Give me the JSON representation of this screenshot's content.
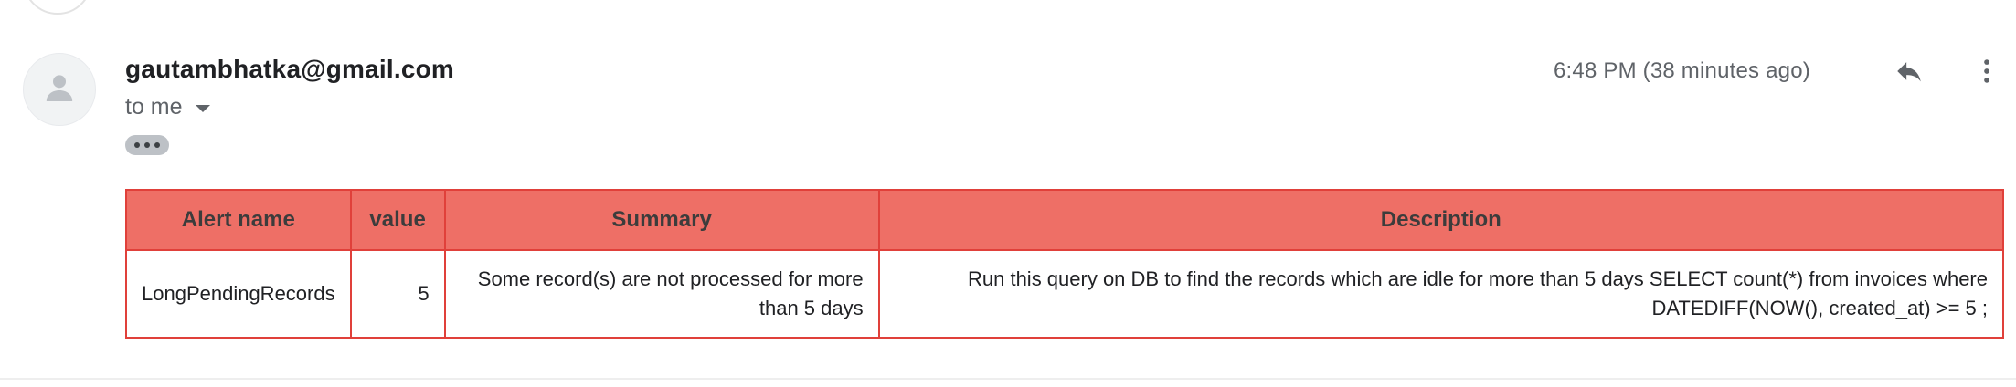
{
  "email": {
    "sender": "gautambhatka@gmail.com",
    "recipients_label": "to me",
    "timestamp": "6:48 PM (38 minutes ago)"
  },
  "icons": {
    "avatar": "person-icon",
    "recipients_toggle": "chevron-down-icon",
    "trimmed_content": "ellipsis-icon",
    "reply": "reply-icon",
    "more": "more-vert-icon"
  },
  "alert_table": {
    "headers": {
      "alert_name": "Alert name",
      "value": "value",
      "summary": "Summary",
      "description": "Description"
    },
    "rows": [
      {
        "alert_name": "LongPendingRecords",
        "value": "5",
        "summary": "Some record(s) are not processed for more than 5 days",
        "description": "Run this query on DB to find the records which are idle for more than 5 days SELECT count(*) from invoices where DATEDIFF(NOW(), created_at) >= 5 ;"
      }
    ]
  },
  "colors": {
    "header_bg": "#ee6f66",
    "table_border": "#e0403a",
    "secondary_text": "#5f6368"
  }
}
